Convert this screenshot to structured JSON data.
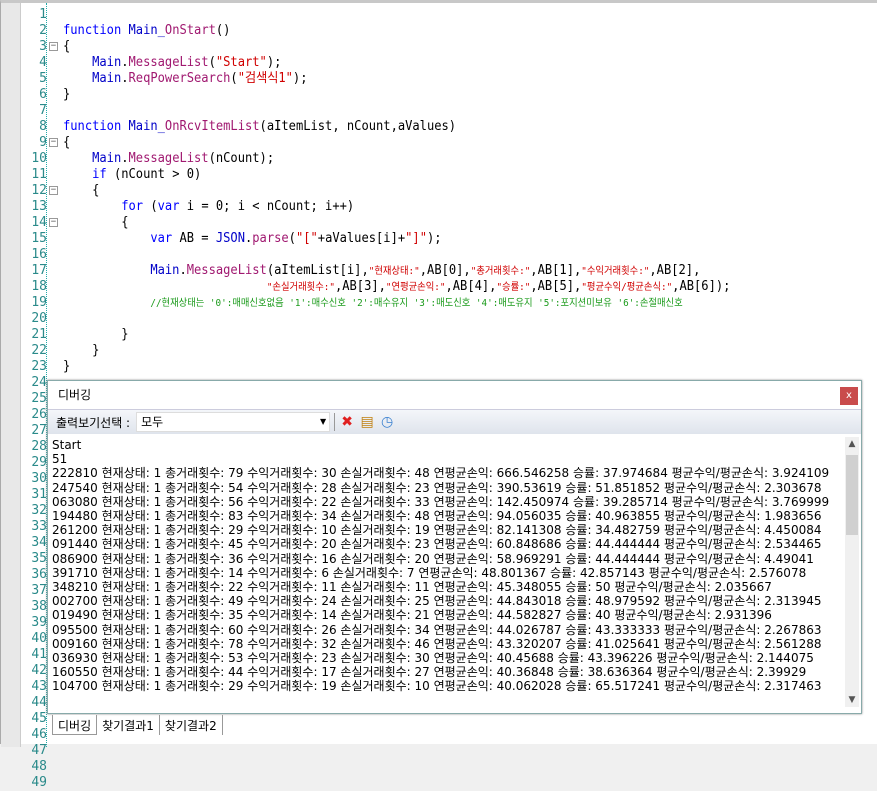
{
  "editor": {
    "lines": [
      [],
      [
        [
          "kw",
          "function "
        ],
        [
          "obj",
          "Main_"
        ],
        [
          "fn",
          "OnStart"
        ],
        [
          "plain",
          "()"
        ]
      ],
      [
        [
          "plain",
          "{"
        ]
      ],
      [
        [
          "plain",
          "    "
        ],
        [
          "obj",
          "Main"
        ],
        [
          "plain",
          "."
        ],
        [
          "fn",
          "MessageList"
        ],
        [
          "plain",
          "("
        ],
        [
          "str",
          "\"Start\""
        ],
        [
          "plain",
          ");"
        ]
      ],
      [
        [
          "plain",
          "    "
        ],
        [
          "obj",
          "Main"
        ],
        [
          "plain",
          "."
        ],
        [
          "fn",
          "ReqPowerSearch"
        ],
        [
          "plain",
          "("
        ],
        [
          "str",
          "\"검색식1\""
        ],
        [
          "plain",
          ");"
        ]
      ],
      [
        [
          "plain",
          "}"
        ]
      ],
      [],
      [
        [
          "kw",
          "function "
        ],
        [
          "obj",
          "Main_"
        ],
        [
          "fn",
          "OnRcvItemList"
        ],
        [
          "plain",
          "(aItemList, nCount,aValues)"
        ]
      ],
      [
        [
          "plain",
          "{"
        ]
      ],
      [
        [
          "plain",
          "    "
        ],
        [
          "obj",
          "Main"
        ],
        [
          "plain",
          "."
        ],
        [
          "fn",
          "MessageList"
        ],
        [
          "plain",
          "(nCount);"
        ]
      ],
      [
        [
          "plain",
          "    "
        ],
        [
          "kw",
          "if"
        ],
        [
          "plain",
          " (nCount > 0)"
        ]
      ],
      [
        [
          "plain",
          "    {"
        ]
      ],
      [
        [
          "plain",
          "        "
        ],
        [
          "kw",
          "for"
        ],
        [
          "plain",
          " ("
        ],
        [
          "kw",
          "var"
        ],
        [
          "plain",
          " i = 0; i < nCount; i++)"
        ]
      ],
      [
        [
          "plain",
          "        {"
        ]
      ],
      [
        [
          "plain",
          "            "
        ],
        [
          "kw",
          "var"
        ],
        [
          "plain",
          " AB = "
        ],
        [
          "obj",
          "JSON"
        ],
        [
          "plain",
          "."
        ],
        [
          "fn",
          "parse"
        ],
        [
          "plain",
          "("
        ],
        [
          "str",
          "\"[\""
        ],
        [
          "plain",
          "+aValues[i]+"
        ],
        [
          "str",
          "\"]\""
        ],
        [
          "plain",
          ");"
        ]
      ],
      [],
      [
        [
          "plain",
          "            "
        ],
        [
          "obj",
          "Main"
        ],
        [
          "plain",
          "."
        ],
        [
          "fn",
          "MessageList"
        ],
        [
          "plain",
          "(aItemList[i],"
        ],
        [
          "str",
          "\"현재상태:\""
        ],
        [
          "plain",
          ",AB[0],"
        ],
        [
          "str",
          "\"총거래횟수:\""
        ],
        [
          "plain",
          ",AB[1],"
        ],
        [
          "str",
          "\"수익거래횟수:\""
        ],
        [
          "plain",
          ",AB[2],"
        ]
      ],
      [
        [
          "plain",
          "                            "
        ],
        [
          "str",
          "\"손실거래횟수:\""
        ],
        [
          "plain",
          ",AB[3],"
        ],
        [
          "str",
          "\"연평균손익:\""
        ],
        [
          "plain",
          ",AB[4],"
        ],
        [
          "str",
          "\"승률:\""
        ],
        [
          "plain",
          ",AB[5],"
        ],
        [
          "str",
          "\"평균수익/평균손식:\""
        ],
        [
          "plain",
          ",AB[6]);"
        ]
      ],
      [
        [
          "plain",
          "            "
        ],
        [
          "cm",
          "//현재상태는 '0':매매신호없음 '1':매수신호 '2':매수유지 '3':매도신호 '4':매도유지 '5':포지션미보유 '6':손절매신호"
        ]
      ],
      [],
      [
        [
          "plain",
          "        }"
        ]
      ],
      [
        [
          "plain",
          "    }"
        ]
      ],
      [
        [
          "plain",
          "}"
        ]
      ],
      [],
      [],
      [],
      [],
      [],
      [],
      [],
      [],
      [],
      [],
      [],
      [],
      [],
      [],
      [],
      [],
      [],
      [],
      [],
      [],
      [],
      [],
      [],
      [],
      [],
      []
    ],
    "fold_lines": [
      3,
      9,
      12,
      14
    ]
  },
  "debug": {
    "title": "디버깅",
    "close": "x",
    "filter_label": "출력보기선택 :",
    "filter_value": "모두",
    "log": [
      "Start",
      "51",
      "222810 현재상태: 1 총거래횟수: 79 수익거래횟수: 30 손실거래횟수: 48 연평균손익: 666.546258 승률: 37.974684 평균수익/평균손식: 3.924109",
      "247540 현재상태: 1 총거래횟수: 54 수익거래횟수: 28 손실거래횟수: 23 연평균손익: 390.53619 승률: 51.851852 평균수익/평균손식: 2.303678",
      "063080 현재상태: 1 총거래횟수: 56 수익거래횟수: 22 손실거래횟수: 33 연평균손익: 142.450974 승률: 39.285714 평균수익/평균손식: 3.769999",
      "194480 현재상태: 1 총거래횟수: 83 수익거래횟수: 34 손실거래횟수: 48 연평균손익: 94.056035 승률: 40.963855 평균수익/평균손식: 1.983656",
      "261200 현재상태: 1 총거래횟수: 29 수익거래횟수: 10 손실거래횟수: 19 연평균손익: 82.141308 승률: 34.482759 평균수익/평균손식: 4.450084",
      "091440 현재상태: 1 총거래횟수: 45 수익거래횟수: 20 손실거래횟수: 23 연평균손익: 60.848686 승률: 44.444444 평균수익/평균손식: 2.534465",
      "086900 현재상태: 1 총거래횟수: 36 수익거래횟수: 16 손실거래횟수: 20 연평균손익: 58.969291 승률: 44.444444 평균수익/평균손식: 4.49041",
      "391710 현재상태: 1 총거래횟수: 14 수익거래횟수: 6 손실거래횟수: 7 연평균손익: 48.801367 승률: 42.857143 평균수익/평균손식: 2.576078",
      "348210 현재상태: 1 총거래횟수: 22 수익거래횟수: 11 손실거래횟수: 11 연평균손익: 45.348055 승률: 50 평균수익/평균손식: 2.035667",
      "002700 현재상태: 1 총거래횟수: 49 수익거래횟수: 24 손실거래횟수: 25 연평균손익: 44.843018 승률: 48.979592 평균수익/평균손식: 2.313945",
      "019490 현재상태: 1 총거래횟수: 35 수익거래횟수: 14 손실거래횟수: 21 연평균손익: 44.582827 승률: 40 평균수익/평균손식: 2.931396",
      "095500 현재상태: 1 총거래횟수: 60 수익거래횟수: 26 손실거래횟수: 34 연평균손익: 44.026787 승률: 43.333333 평균수익/평균손식: 2.267863",
      "009160 현재상태: 1 총거래횟수: 78 수익거래횟수: 32 손실거래횟수: 46 연평균손익: 43.320207 승률: 41.025641 평균수익/평균손식: 2.561288",
      "036930 현재상태: 1 총거래횟수: 53 수익거래횟수: 23 손실거래횟수: 30 연평균손익: 40.45688 승률: 43.396226 평균수익/평균손식: 2.144075",
      "160550 현재상태: 1 총거래횟수: 44 수익거래횟수: 17 손실거래횟수: 27 연평균손익: 40.36848 승률: 38.636364 평균수익/평균손식: 2.39929",
      "104700 현재상태: 1 총거래횟수: 29 수익거래횟수: 19 손실거래횟수: 10 연평균손익: 40.062028 승률: 65.517241 평균수익/평균손식: 2.317463"
    ]
  },
  "tabs": [
    {
      "label": "디버깅",
      "active": true
    },
    {
      "label": "찾기결과1"
    },
    {
      "label": "찾기결과2"
    }
  ]
}
